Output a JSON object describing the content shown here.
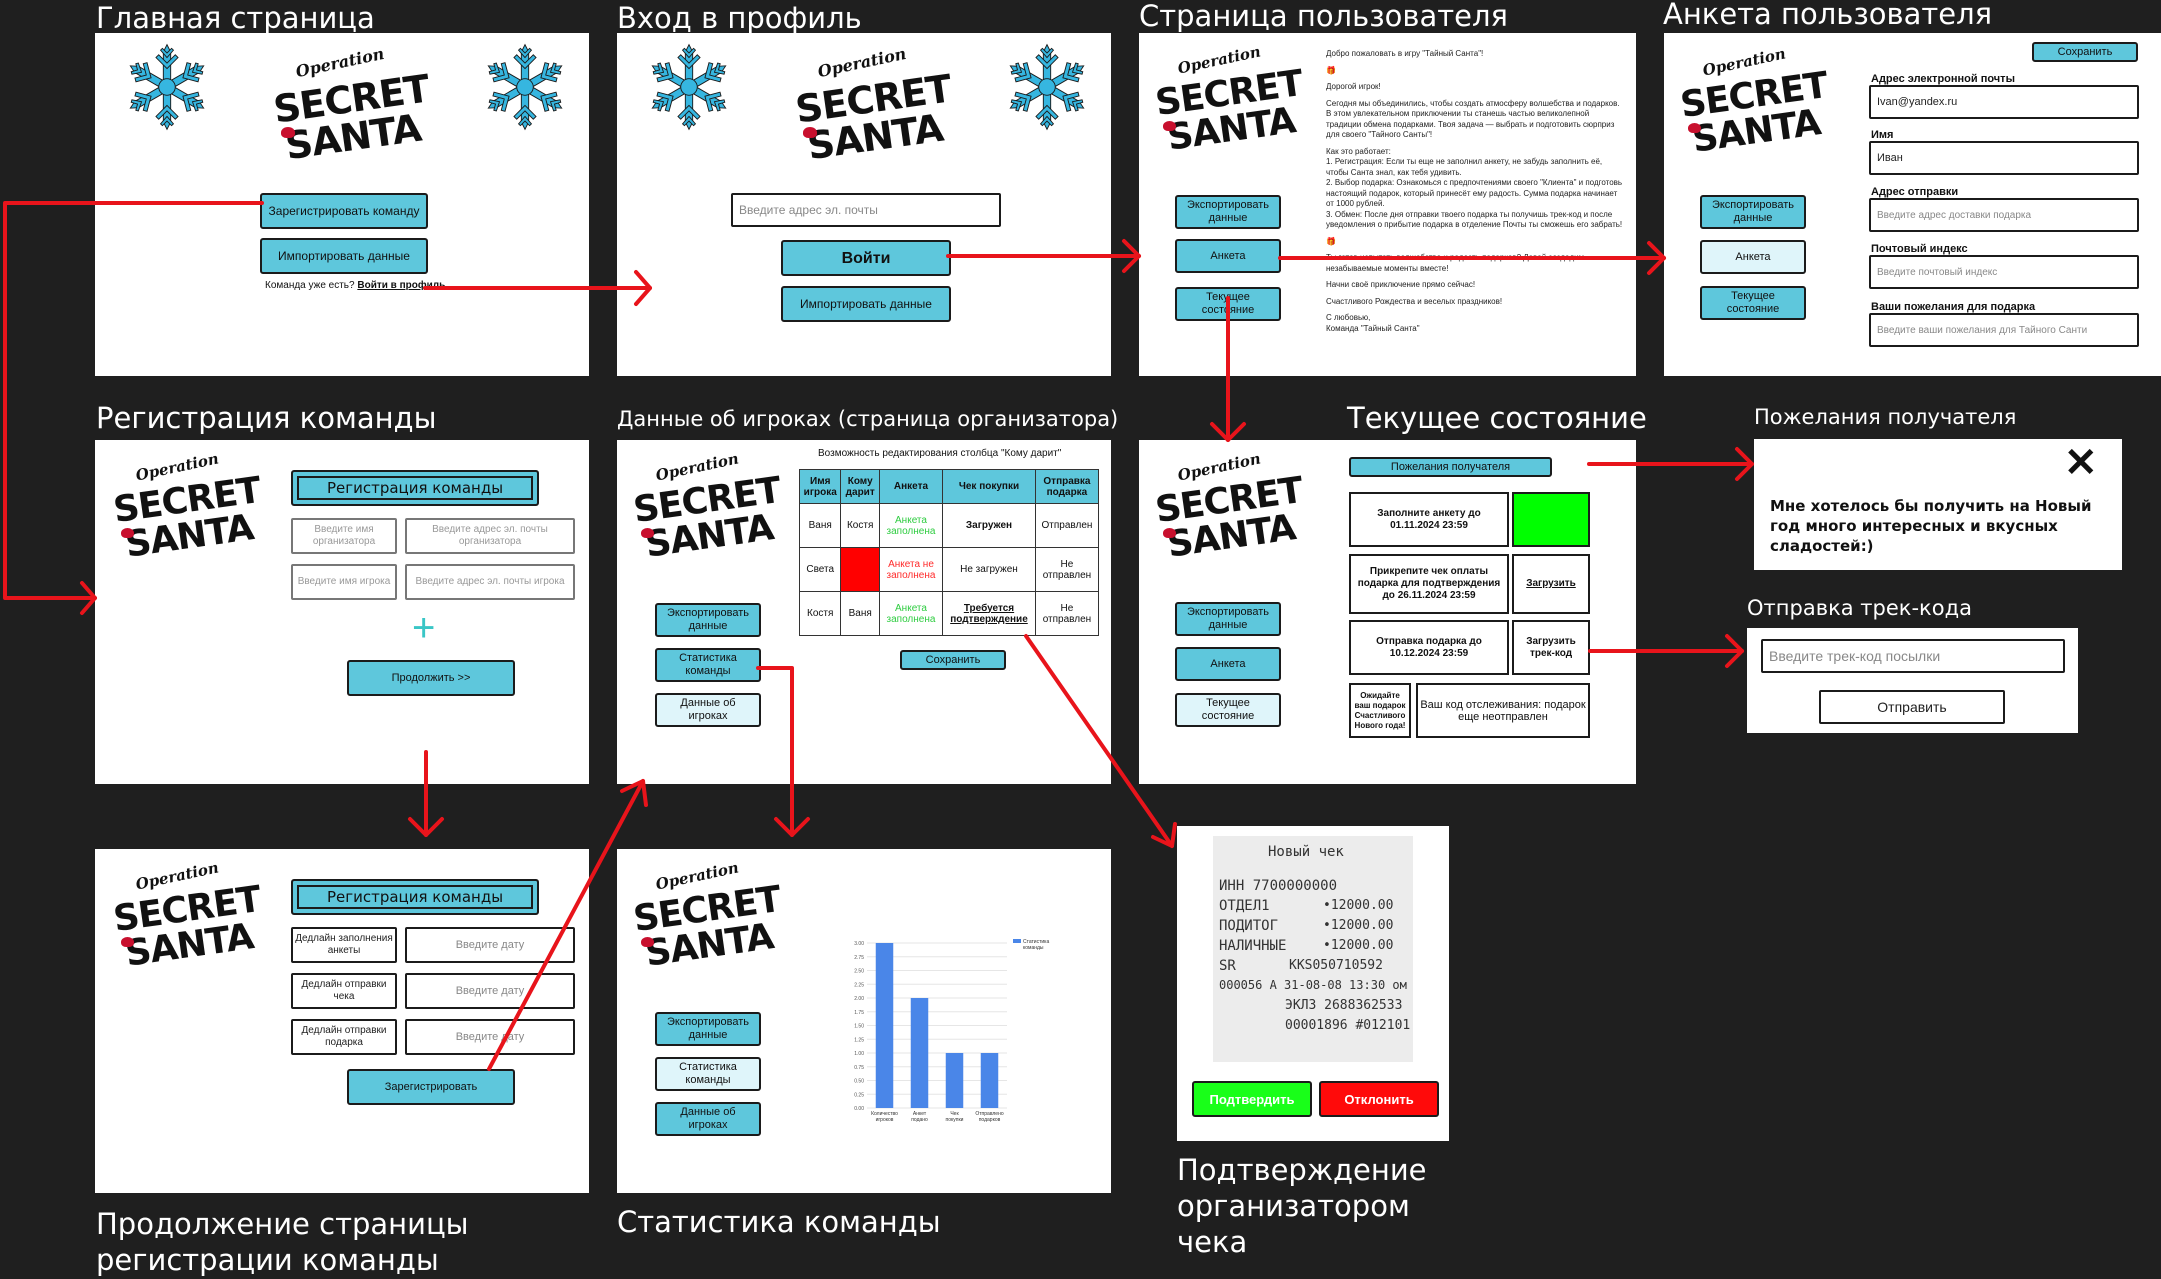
{
  "titles": {
    "main": "Главная страница",
    "login": "Вход в профиль",
    "user_page": "Страница пользователя",
    "user_form": "Анкета пользователя",
    "team_reg": "Регистрация команды",
    "org_players": "Данные об игроках (страница организатора)",
    "status": "Текущее состояние",
    "wishes": "Пожелания получателя",
    "track": "Отправка трек-кода",
    "reg_cont": "Продолжение страницы регистрации команды",
    "stats": "Статистика команды",
    "receipt_confirm": "Подтверждение организатором чека"
  },
  "logo": {
    "top": "Operation",
    "line1": "SECRET",
    "line2": "SANTA"
  },
  "main": {
    "register_btn": "Зарегистрировать команду",
    "import_btn": "Импортировать данные",
    "have_team": "Команда уже есть?",
    "login_link": "Войти в профиль"
  },
  "login": {
    "email_placeholder": "Введите адрес эл. почты",
    "enter_btn": "Войти",
    "import_btn": "Импортировать данные"
  },
  "nav": {
    "export": "Экспортировать данные",
    "form": "Анкета",
    "status": "Текущее состояние",
    "team_stats": "Статистика команды",
    "players": "Данные об игроках"
  },
  "user_page": {
    "letter": [
      "Добро пожаловать в игру \"Тайный Санта\"!",
      "🎁",
      "Дорогой игрок!",
      "Сегодня мы объединились, чтобы создать атмосферу волшебства и подарков. В этом увлекательном приключении ты станешь частью великолепной традиции обмена подарками. Твоя задача — выбрать и подготовить сюрприз для своего \"Тайного Санты\"!",
      "Как это работает:\n1. Регистрация: Если ты еще не заполнил анкету, не забудь заполнить её, чтобы Санта знал, как тебя удивить.\n2. Выбор подарка: Ознакомься с предпочтениями своего \"Клиента\" и подготовь настоящий подарок, который принесёт ему радость. Сумма подарка начинает от 1000 рублей.\n3. Обмен: После дня отправки твоего подарка ты получишь трек-код и после уведомления о прибытие подарка в отделение Почты ты сможешь его забрать!",
      "🎁",
      "Ты готов испытать волшебство и радость подарков? Давай создадим незабываемые моменты вместе!",
      "Начни своё приключение прямо сейчас!",
      "Счастливого Рождества и веселых праздников!",
      "С любовью,\nКоманда \"Тайный Санта\""
    ]
  },
  "user_form": {
    "save_btn": "Сохранить",
    "email_label": "Адрес электронной почты",
    "email_value": "Ivan@yandex.ru",
    "name_label": "Имя",
    "name_value": "Иван",
    "address_label": "Адрес отправки",
    "address_placeholder": "Введите адрес доставки подарка",
    "zip_label": "Почтовый индекс",
    "zip_placeholder": "Введите почтовый индекс",
    "wishes_label": "Ваши пожелания для подарка",
    "wishes_placeholder": "Введите ваши пожелания для Тайного Санти"
  },
  "team_reg": {
    "header": "Регистрация команды",
    "org_name": "Введите имя организатора",
    "org_email": "Введите адрес эл. почты организатора",
    "player_name": "Введите имя игрока",
    "player_email": "Введите адрес эл. почты игрока",
    "plus": "+",
    "continue_btn": "Продолжить >>"
  },
  "org": {
    "caption": "Возможность редактирования столбца \"Кому дарит\"",
    "headers": [
      "Имя игрока",
      "Кому дарит",
      "Анкета",
      "Чек покупки",
      "Отправка подарка"
    ],
    "rows": [
      [
        "Ваня",
        "Костя",
        "Анкета заполнена",
        "Загружен",
        "Отправлен"
      ],
      [
        "Света",
        "",
        "Анкета не заполнена",
        "Не загружен",
        "Не отправлен"
      ],
      [
        "Костя",
        "Ваня",
        "Анкета заполнена",
        "Требуется подтверждение",
        "Не отправлен"
      ]
    ],
    "save_btn": "Сохранить"
  },
  "status": {
    "wishes_btn": "Пожелания получателя",
    "form_deadline": "Заполните анкету до 01.11.2024 23:59",
    "receipt_deadline": "Прикрепите чек оплаты подарка для подтверждения до 26.11.2024 23:59",
    "upload_btn": "Загрузить",
    "send_deadline": "Отправка подарка до 10.12.2024 23:59",
    "upload_track_btn": "Загрузить трек-код",
    "gift_wait": "Ожидайте ваш подарок Счастливого Нового года!",
    "track_info": "Ваш код отслеживания: подарок еще неотправлен",
    "done_color": "#00ff00"
  },
  "wishes": {
    "close": "✕",
    "text": "Мне хотелось бы получить на Новый год много интересных и вкусных сладостей:)"
  },
  "track": {
    "placeholder": "Введите трек-код посылки",
    "send_btn": "Отправить"
  },
  "reg_cont": {
    "header": "Регистрация команды",
    "rows": [
      {
        "label": "Дедлайн заполнения анкеты",
        "placeholder": "Введите дату"
      },
      {
        "label": "Дедлайн отправки чека",
        "placeholder": "Введите дату"
      },
      {
        "label": "Дедлайн отправки подарка",
        "placeholder": "Введите дату"
      }
    ],
    "register_btn": "Зарегистрировать"
  },
  "receipt": {
    "title": "Новый чек",
    "lines": [
      "ИНН 7700000000",
      "ОТДЕЛ1",
      "ПОДИТОГ",
      "НАЛИЧНЫЕ",
      "SR",
      "000056 А 31-08-08 13:30 ом",
      "ЭКЛЗ 2688362533",
      "00001896 #012101"
    ],
    "amounts": [
      "•12000.00",
      "•12000.00",
      "•12000.00",
      "KKS050710592"
    ],
    "confirm_btn": "Подтвердить",
    "reject_btn": "Отклонить",
    "confirm_color": "#19ff19",
    "reject_color": "#ff0a0a"
  },
  "chart_data": {
    "type": "bar",
    "categories": [
      "Количество игроков",
      "Анкет подано",
      "Чек покупки",
      "Отправлено подарков"
    ],
    "values": [
      3,
      2,
      1,
      1
    ],
    "ylim": [
      0,
      3
    ],
    "yticks": [
      "0.00",
      "0.25",
      "0.50",
      "0.75",
      "1.00",
      "1.25",
      "1.50",
      "1.75",
      "2.00",
      "2.25",
      "2.50",
      "2.75",
      "3.00"
    ],
    "legend": "Статистика команды",
    "legend_position": "top-right",
    "bar_color": "#4a86e8",
    "grid": true
  },
  "colors": {
    "accent": "#5ec7dc",
    "arrow": "#e8141b",
    "red_cell": "#ff0000",
    "green_text": "#2ecc40",
    "red_text": "#ff2a2a"
  }
}
